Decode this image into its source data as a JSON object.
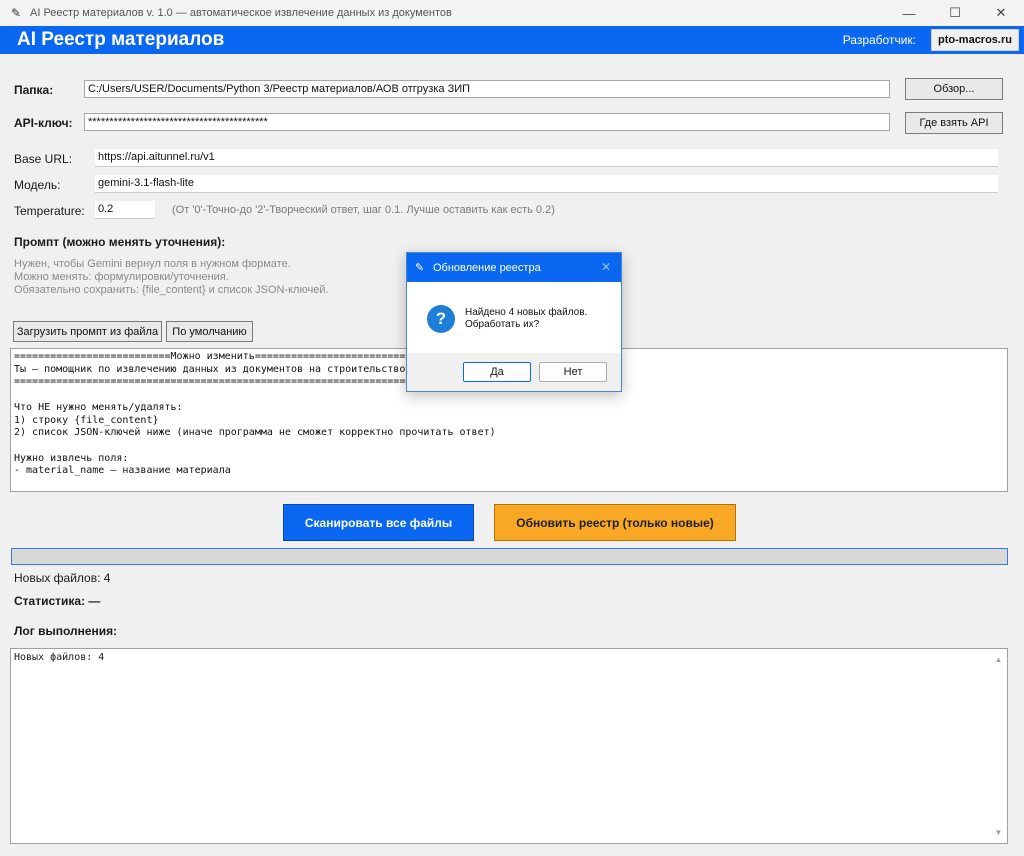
{
  "window": {
    "title": "AI Реестр материалов v. 1.0 — автоматическое извлечение данных из документов",
    "minimize": "—",
    "maximize": "☐",
    "close": "✕"
  },
  "header": {
    "title": "AI Реестр материалов",
    "developer_label": "Разработчик:",
    "developer_link": "pto-macros.ru",
    "accent_color": "#0a67f2"
  },
  "form": {
    "folder_label": "Папка:",
    "folder_value": "C:/Users/USER/Documents/Python 3/Реестр материалов/АОВ отгрузка ЗИП",
    "browse_button": "Обзор...",
    "api_key_label": "API-ключ:",
    "api_key_value": "******************************************",
    "get_api_button": "Где взять API",
    "base_url_label": "Base URL:",
    "base_url_value": "https://api.aitunnel.ru/v1",
    "model_label": "Модель:",
    "model_value": "gemini-3.1-flash-lite",
    "temperature_label": "Temperature:",
    "temperature_value": "0.2",
    "temperature_hint": "(От '0'-Точно-до '2'-Творческий ответ, шаг 0.1. Лучше оставить как есть 0.2)"
  },
  "prompt": {
    "heading": "Промпт (можно менять уточнения):",
    "help_line1": "Нужен, чтобы Gemini вернул поля в нужном формате.",
    "help_line2": "Можно менять: формулировки/уточнения.",
    "help_line3": "Обязательно сохранить: {file_content} и список JSON-ключей.",
    "load_button": "Загрузить промпт из файла",
    "default_button": "По умолчанию",
    "text": "==========================Можно изменить==========================\nТы — помощник по извлечению данных из документов на строительство\n==================================================================\n\nЧто НЕ нужно менять/удалять:\n1) строку {file_content}\n2) список JSON-ключей ниже (иначе программа не сможет корректно прочитать ответ)\n\nНужно извлечь поля:\n- material_name — название материала"
  },
  "actions": {
    "scan_button": "Сканировать все файлы",
    "update_button": "Обновить реестр (только новые)",
    "scan_color": "#0a67f2",
    "update_color": "#f8a825"
  },
  "progress": {
    "fraction": 0
  },
  "status": {
    "new_files": "Новых файлов: 4",
    "stats": "Статистика: —",
    "log_heading": "Лог выполнения:",
    "log_text": "Новых файлов: 4"
  },
  "dialog": {
    "title": "Обновление реестра",
    "close": "✕",
    "icon": "?",
    "message": "Найдено 4 новых файлов.\nОбработать их?",
    "yes_button": "Да",
    "no_button": "Нет"
  }
}
